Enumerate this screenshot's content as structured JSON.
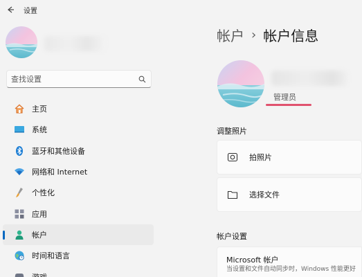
{
  "window": {
    "title": "设置"
  },
  "search": {
    "placeholder": "查找设置"
  },
  "nav": {
    "items": [
      {
        "label": "主页",
        "icon": "home-icon"
      },
      {
        "label": "系统",
        "icon": "monitor-icon"
      },
      {
        "label": "蓝牙和其他设备",
        "icon": "bluetooth-icon"
      },
      {
        "label": "网络和 Internet",
        "icon": "wifi-icon"
      },
      {
        "label": "个性化",
        "icon": "brush-icon"
      },
      {
        "label": "应用",
        "icon": "apps-icon"
      },
      {
        "label": "帐户",
        "icon": "account-icon",
        "active": true
      },
      {
        "label": "时间和语言",
        "icon": "globe-clock-icon"
      },
      {
        "label": "游戏",
        "icon": "game-icon"
      }
    ]
  },
  "breadcrumb": {
    "parent": "帐户",
    "separator": "›",
    "current": "帐户信息"
  },
  "profile": {
    "role": "管理员"
  },
  "photo_section": {
    "title": "调整照片",
    "take_photo": "拍照片",
    "choose_file": "选择文件"
  },
  "account_settings": {
    "title": "帐户设置",
    "microsoft_account_title": "Microsoft 帐户",
    "microsoft_account_desc": "当设置和文件自动同步时，Windows 性能更好"
  },
  "colors": {
    "accent": "#0067c0",
    "highlight": "#e0526e",
    "background": "#f3f3f3"
  }
}
